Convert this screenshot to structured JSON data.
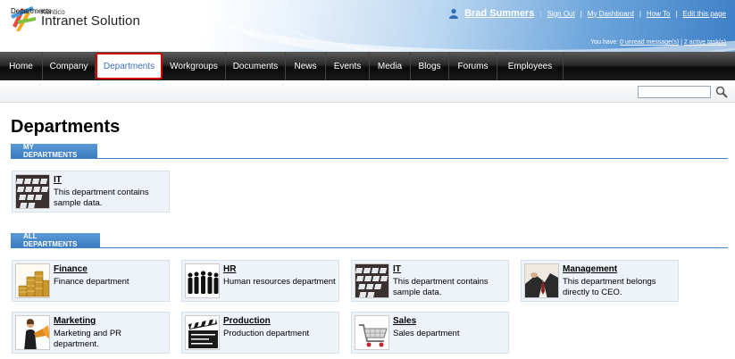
{
  "header": {
    "brand_small": "Kentico",
    "brand_big": "Intranet Solution",
    "user_name": "Brad Summers",
    "user_colon": ":",
    "links": [
      "Sign Out",
      "My Dashboard",
      "How To",
      "Edit this page"
    ],
    "tasks_prefix": "You have:",
    "unread_messages": "0 unread message(s)",
    "active_tasks": "2 active task(s)"
  },
  "nav": {
    "items": [
      "Home",
      "Company",
      "Departments",
      "Workgroups",
      "Documents",
      "News",
      "Events",
      "Media",
      "Blogs",
      "Forums",
      "Employees"
    ],
    "active": "Departments"
  },
  "breadcrumb": "Departments",
  "search": {
    "value": ""
  },
  "page_title": "Departments",
  "my_departments": {
    "heading": "MY DEPARTMENTS",
    "cards": [
      {
        "name": "IT",
        "desc": "This department contains sample data.",
        "icon": "keyboard-icon"
      }
    ]
  },
  "all_departments": {
    "heading": "ALL DEPARTMENTS",
    "cards": [
      {
        "name": "Finance",
        "desc": "Finance department",
        "icon": "coins-icon"
      },
      {
        "name": "HR",
        "desc": "Human resources department",
        "icon": "people-icon"
      },
      {
        "name": "IT",
        "desc": "This department contains sample data.",
        "icon": "keyboard-icon"
      },
      {
        "name": "Management",
        "desc": "This department belongs directly to CEO.",
        "icon": "businessman-icon"
      },
      {
        "name": "Marketing",
        "desc": "Marketing and PR department.",
        "icon": "megaphone-icon"
      },
      {
        "name": "Production",
        "desc": "Production department",
        "icon": "clapperboard-icon"
      },
      {
        "name": "Sales",
        "desc": "Sales department",
        "icon": "shopping-cart-icon"
      }
    ]
  },
  "colors": {
    "accent": "#3a7cc0",
    "nav_bg": "#1a1a1a",
    "card_bg": "#edf3f9",
    "highlight": "#d40000"
  }
}
